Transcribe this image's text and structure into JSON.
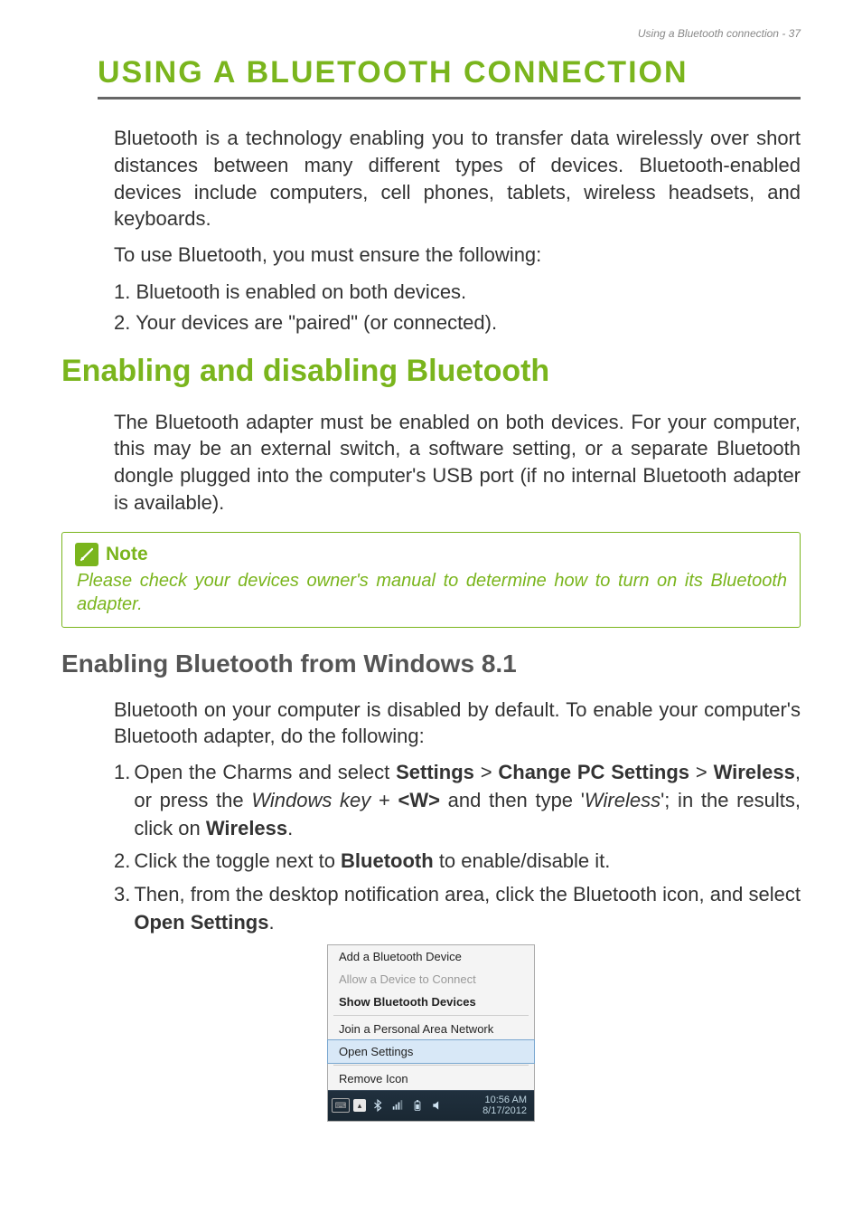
{
  "header": {
    "pageinfo": "Using a Bluetooth connection - 37"
  },
  "title": {
    "sc1": "U",
    "rest1": "SING A ",
    "sc2": "B",
    "rest2": "LUETOOTH CONNECTION"
  },
  "title_full": "USING A BLUETOOTH CONNECTION",
  "intro": "Bluetooth is a technology enabling you to transfer data wirelessly over short distances between many different types of devices. Bluetooth-enabled devices include computers, cell phones, tablets, wireless headsets, and keyboards.",
  "intro_lead": "To use Bluetooth, you must ensure the following:",
  "list1": [
    "1. Bluetooth is enabled on both devices.",
    "2. Your devices are \"paired\" (or connected)."
  ],
  "h2": "Enabling and disabling Bluetooth",
  "para2": "The Bluetooth adapter must be enabled on both devices. For your computer, this may be an external switch, a software setting, or a separate Bluetooth dongle plugged into the computer's USB port (if no internal Bluetooth adapter is available).",
  "note": {
    "title": "Note",
    "body": "Please check your devices owner's manual to determine how to turn on its Bluetooth adapter."
  },
  "h3": "Enabling Bluetooth from Windows 8.1",
  "para3": "Bluetooth on your computer is disabled by default. To enable your computer's Bluetooth adapter, do the following:",
  "steps": {
    "s1": {
      "num": "1.",
      "a": "Open the Charms and select ",
      "b": "Settings",
      "c": " > ",
      "d": "Change PC Settings",
      "e": " > ",
      "f": "Wireless",
      "g": ", or press the ",
      "h": "Windows key",
      "i": " + ",
      "j": "<W>",
      "k": " and then type '",
      "l": "Wireless",
      "m": "'; in the results, click on ",
      "n": "Wireless",
      "o": "."
    },
    "s2": {
      "num": "2.",
      "a": "Click the toggle next to ",
      "b": "Bluetooth",
      "c": " to enable/disable it."
    },
    "s3": {
      "num": "3.",
      "a": "Then, from the desktop notification area, click the Bluetooth icon, and select ",
      "b": "Open Settings",
      "c": "."
    }
  },
  "tray": {
    "items": [
      {
        "label": "Add a Bluetooth Device",
        "style": "normal"
      },
      {
        "label": "Allow a Device to Connect",
        "style": "disabled"
      },
      {
        "label": "Show Bluetooth Devices",
        "style": "bold"
      },
      {
        "label": "Join a Personal Area Network",
        "style": "normal"
      },
      {
        "label": "Open Settings",
        "style": "hover"
      },
      {
        "label": "Remove Icon",
        "style": "normal"
      }
    ],
    "time": "10:56 AM",
    "date": "8/17/2012"
  }
}
